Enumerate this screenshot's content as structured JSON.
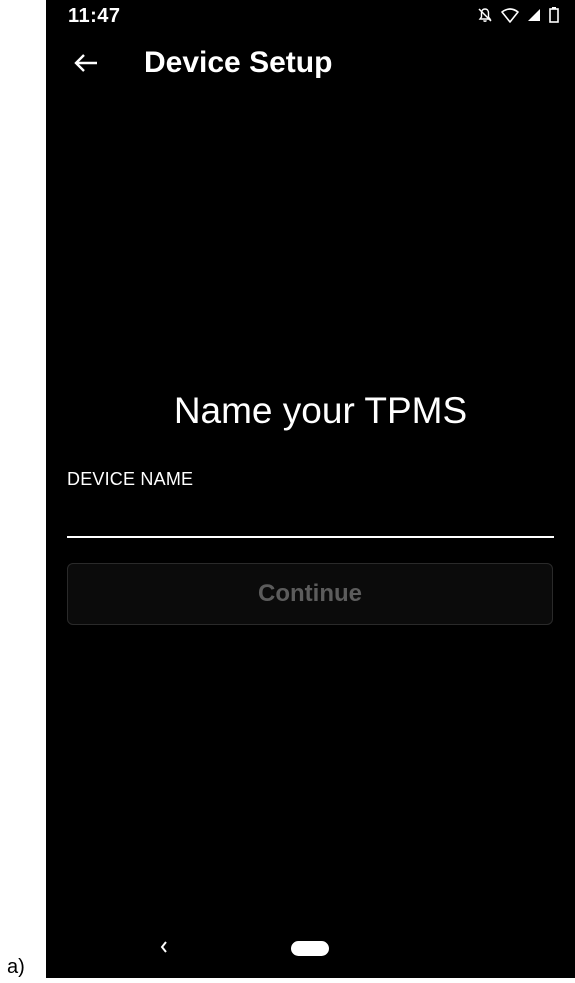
{
  "figure_label": "a)",
  "status_bar": {
    "time": "11:47",
    "icons": [
      "notifications-off-icon",
      "wifi-icon",
      "signal-icon",
      "battery-icon"
    ]
  },
  "app_bar": {
    "back_icon": "arrow-left-icon",
    "title": "Device Setup"
  },
  "main": {
    "heading": "Name your TPMS",
    "device_name": {
      "label": "DEVICE NAME",
      "value": "",
      "placeholder": ""
    },
    "continue_label": "Continue"
  },
  "nav_bar": {
    "back_icon": "nav-back-icon",
    "home_icon": "home-pill-icon"
  },
  "colors": {
    "background": "#000000",
    "text": "#ffffff",
    "disabled_text": "#5c5c5c"
  }
}
